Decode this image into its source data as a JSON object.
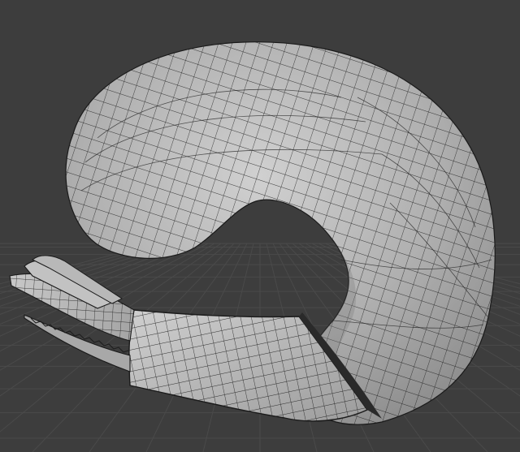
{
  "viewport": {
    "background_color": "#3d3d3d",
    "grid_color": "#4a4a4a",
    "mesh_fill_color": "#b4b4b4",
    "mesh_wire_color": "#1e1e1e",
    "shading": "solid",
    "overlay": "wireframe"
  },
  "scene": {
    "objects": [
      {
        "name_icon": "mesh-object-icon",
        "kind": "curled-tube-mesh"
      }
    ]
  }
}
